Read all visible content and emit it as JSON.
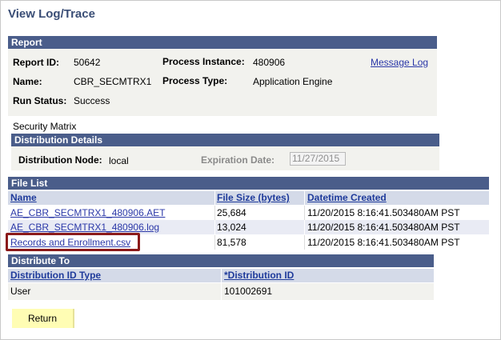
{
  "page_title": "View Log/Trace",
  "report": {
    "header": "Report",
    "report_id_label": "Report ID:",
    "report_id": "50642",
    "process_instance_label": "Process Instance:",
    "process_instance": "480906",
    "message_log_link": "Message Log",
    "name_label": "Name:",
    "name": "CBR_SECMTRX1",
    "process_type_label": "Process Type:",
    "process_type": "Application Engine",
    "run_status_label": "Run Status:",
    "run_status": "Success"
  },
  "description": "Security Matrix",
  "distribution_details": {
    "header": "Distribution Details",
    "node_label": "Distribution Node:",
    "node": "local",
    "expiration_label": "Expiration Date:",
    "expiration_date": "11/27/2015"
  },
  "file_list": {
    "header": "File List",
    "columns": {
      "name": "Name",
      "size": "File Size (bytes)",
      "created": "Datetime Created"
    },
    "rows": [
      {
        "name": "AE_CBR_SECMTRX1_480906.AET",
        "size": "25,684",
        "created": "11/20/2015  8:16:41.503480AM PST"
      },
      {
        "name": "AE_CBR_SECMTRX1_480906.log",
        "size": "13,024",
        "created": "11/20/2015  8:16:41.503480AM PST"
      },
      {
        "name": "Records and Enrollment.csv",
        "size": "81,578",
        "created": "11/20/2015  8:16:41.503480AM PST"
      }
    ]
  },
  "distribute_to": {
    "header": "Distribute To",
    "columns": {
      "type": "Distribution ID Type",
      "id": "*Distribution ID"
    },
    "rows": [
      {
        "type": "User",
        "id": "101002691"
      }
    ]
  },
  "return_button": "Return",
  "colors": {
    "header_bar": "#4a5d8a",
    "column_header": "#d4dae8",
    "link": "#2b38a8",
    "highlight_box": "#8b1a1a",
    "return_button": "#fffdb4"
  }
}
